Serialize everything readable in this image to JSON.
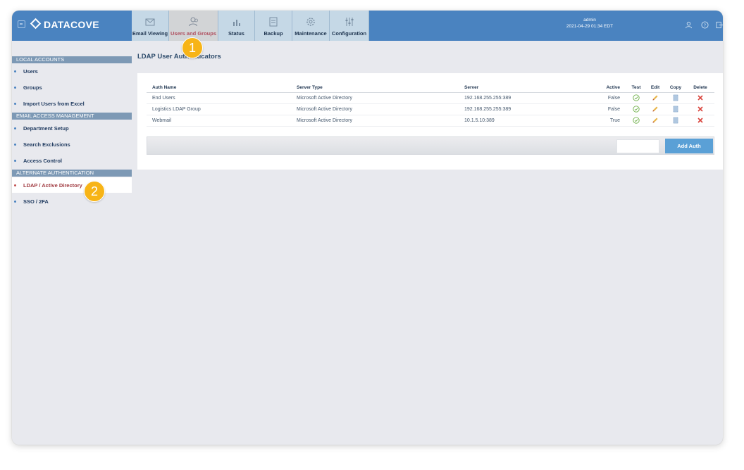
{
  "brand": {
    "name": "DATACOVE"
  },
  "nav": {
    "tabs": [
      {
        "label": "Email Viewing",
        "icon": "envelope-icon"
      },
      {
        "label": "Users and Groups",
        "icon": "users-icon"
      },
      {
        "label": "Status",
        "icon": "bar-chart-icon"
      },
      {
        "label": "Backup",
        "icon": "archive-icon"
      },
      {
        "label": "Maintenance",
        "icon": "gear-icon"
      },
      {
        "label": "Configuration",
        "icon": "sliders-icon"
      }
    ],
    "active": "Users and Groups"
  },
  "user": {
    "name": "admin",
    "datetime": "2021-04-29 01:34 EDT"
  },
  "sidebar": {
    "sections": [
      {
        "title": "LOCAL ACCOUNTS",
        "items": [
          "Users",
          "Groups",
          "Import Users from Excel"
        ]
      },
      {
        "title": "EMAIL ACCESS MANAGEMENT",
        "items": [
          "Department Setup",
          "Search Exclusions",
          "Access Control"
        ]
      },
      {
        "title": "ALTERNATE AUTHENTICATION",
        "items": [
          "LDAP / Active Directory",
          "SSO / 2FA"
        ]
      }
    ],
    "active_item": "LDAP / Active Directory"
  },
  "main": {
    "title": "LDAP User Authenticators",
    "table": {
      "headers": [
        "Auth Name",
        "Server Type",
        "Server",
        "Active",
        "Test",
        "Edit",
        "Copy",
        "Delete"
      ],
      "rows": [
        {
          "auth_name": "End Users",
          "server_type": "Microsoft Active Directory",
          "server": "192.168.255.255:389",
          "active": "False"
        },
        {
          "auth_name": "Logistics LDAP Group",
          "server_type": "Microsoft Active Directory",
          "server": "192.168.255.255:389",
          "active": "False"
        },
        {
          "auth_name": "Webmail",
          "server_type": "Microsoft Active Directory",
          "server": "10.1.5.10:389",
          "active": "True"
        }
      ]
    },
    "add_button": "Add Auth"
  },
  "callouts": [
    "1",
    "2"
  ],
  "colors": {
    "topbar": "#4a83c0",
    "accent": "#5aa0d6",
    "badge": "#f7b417",
    "active_text": "#a03a40"
  }
}
